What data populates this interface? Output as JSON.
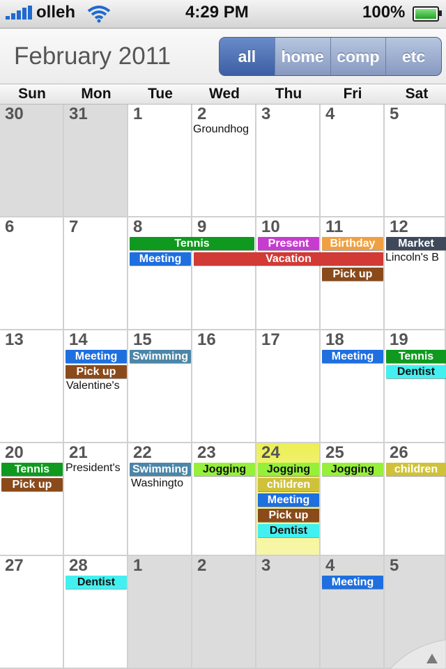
{
  "status": {
    "carrier": "olleh",
    "time": "4:29 PM",
    "battery": "100%"
  },
  "header": {
    "month": "February 2011",
    "filters": [
      "all",
      "home",
      "comp",
      "etc"
    ],
    "selected_filter": "all"
  },
  "weekdays": [
    "Sun",
    "Mon",
    "Tue",
    "Wed",
    "Thu",
    "Fri",
    "Sat"
  ],
  "weeks": [
    [
      "30",
      "31",
      "1",
      "2",
      "3",
      "4",
      "5"
    ],
    [
      "6",
      "7",
      "8",
      "9",
      "10",
      "11",
      "12"
    ],
    [
      "13",
      "14",
      "15",
      "16",
      "17",
      "18",
      "19"
    ],
    [
      "20",
      "21",
      "22",
      "23",
      "24",
      "25",
      "26"
    ],
    [
      "27",
      "28",
      "1",
      "2",
      "3",
      "4",
      "5"
    ]
  ],
  "notes": {
    "w0d3": "Groundhog",
    "w1d6": "Lincoln's B",
    "w2d1": "Valentine's",
    "w3d1": "President's",
    "w3d2": "Washingto"
  },
  "events": {
    "tennis_w1": "Tennis",
    "present": "Present",
    "birthday": "Birthday",
    "market": "Market",
    "meeting_w1": "Meeting",
    "vacation": "Vacation",
    "pickup_w1": "Pick up",
    "meeting_w2a": "Meeting",
    "swimming_w2": "Swimming",
    "meeting_w2b": "Meeting",
    "tennis_w2": "Tennis",
    "pickup_w2": "Pick up",
    "dentist_w2": "Dentist",
    "tennis_w3": "Tennis",
    "swimming_w3": "Swimming",
    "jogging_w3a": "Jogging",
    "jogging_w3b": "Jogging",
    "jogging_w3c": "Jogging",
    "children_w3a": "children",
    "children_w3b": "children",
    "pickup_w3a": "Pick up",
    "meeting_w3": "Meeting",
    "pickup_w3b": "Pick up",
    "dentist_w3": "Dentist",
    "dentist_w4": "Dentist",
    "meeting_w4": "Meeting"
  },
  "colors": {
    "green": "#0f9a1f",
    "magenta": "#c63ccf",
    "orange": "#f0a040",
    "slate": "#3e4a5a",
    "blue": "#1e6fe0",
    "red": "#d23a36",
    "brown": "#8a4a1a",
    "steel": "#4b86a8",
    "cyan": "#42f0f0",
    "lime": "#96f03a",
    "olive": "#cfc23a",
    "today": "#f0f060"
  }
}
